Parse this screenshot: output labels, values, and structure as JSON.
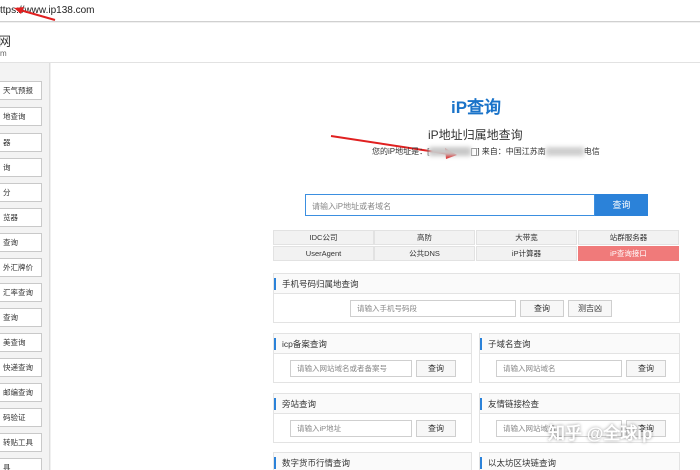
{
  "browser": {
    "url": "ttps://www.ip138.com"
  },
  "site": {
    "logo_text": "网",
    "logo_sub": "m"
  },
  "sidebar": {
    "items": [
      {
        "label": "天气预报"
      },
      {
        "label": "地查询"
      },
      {
        "label": "器"
      },
      {
        "label": "询"
      },
      {
        "label": "分"
      },
      {
        "label": "览器"
      },
      {
        "label": "查询"
      },
      {
        "label": "外汇牌价"
      },
      {
        "label": "汇率查询"
      },
      {
        "label": "查询"
      },
      {
        "label": "美查询"
      },
      {
        "label": "快递查询"
      },
      {
        "label": "邮编查询"
      },
      {
        "label": "码验证"
      },
      {
        "label": "转贴工具"
      },
      {
        "label": "具"
      }
    ]
  },
  "header": {
    "brand": "iP查询",
    "title": "iP地址归属地查询",
    "ip_prefix": "您的iP地址是：[",
    "ip_from": "] 来自：中国江苏南",
    "ip_isp": "电信"
  },
  "search": {
    "placeholder": "请输入iP地址或者域名",
    "button": "查询"
  },
  "nav": {
    "row1": [
      "IDC公司",
      "高防",
      "大带宽",
      "站群服务器"
    ],
    "row2": [
      "UserAgent",
      "公共DNS",
      "iP计算器",
      "iP查询接口"
    ]
  },
  "phone": {
    "title": "手机号码归属地查询",
    "placeholder": "请输入手机号码段",
    "query": "查询",
    "fortune": "测吉凶"
  },
  "icp": {
    "title": "icp备案查询",
    "placeholder": "请输入网站域名或者备案号",
    "query": "查询"
  },
  "subdomain": {
    "title": "子域名查询",
    "placeholder": "请输入网站域名",
    "query": "查询"
  },
  "sidesite": {
    "title": "旁站查询",
    "placeholder": "请输入iP地址",
    "query": "查询"
  },
  "friendlink": {
    "title": "友情链接检查",
    "placeholder": "请输入网站域名",
    "query": "查询"
  },
  "crypto": {
    "title": "数字货币行情查询"
  },
  "eth": {
    "title": "以太坊区块链查询"
  },
  "watermark": "知乎 @全球ip"
}
